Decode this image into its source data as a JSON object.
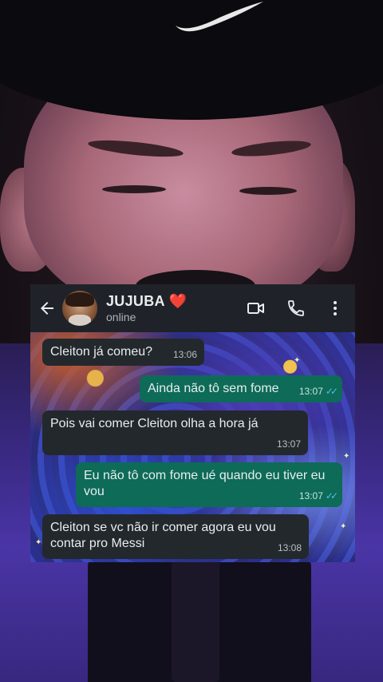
{
  "contact": {
    "name": "JUJUBA",
    "heart": "❤️",
    "status": "online"
  },
  "header_icons": [
    "back-arrow-icon",
    "avatar",
    "video-call-icon",
    "voice-call-icon",
    "more-options-icon"
  ],
  "colors": {
    "header_bg": "#1f2329",
    "incoming_bubble": "#23282d",
    "outgoing_bubble": "#0d6b58",
    "read_ticks": "#53bdeb"
  },
  "messages": [
    {
      "direction": "in",
      "text": "Cleiton já comeu?",
      "time": "13:06"
    },
    {
      "direction": "out",
      "text": "Ainda não tô sem fome",
      "time": "13:07",
      "ticks": "✓✓"
    },
    {
      "direction": "in",
      "text": "Pois vai comer Cleiton olha a hora já",
      "time": "13:07"
    },
    {
      "direction": "out",
      "text": "Eu não tô com fome ué quando eu tiver eu vou",
      "time": "13:07",
      "ticks": "✓✓"
    },
    {
      "direction": "in",
      "text": "Cleiton se vc não ir comer agora eu vou contar pro Messi",
      "time": "13:08"
    }
  ]
}
